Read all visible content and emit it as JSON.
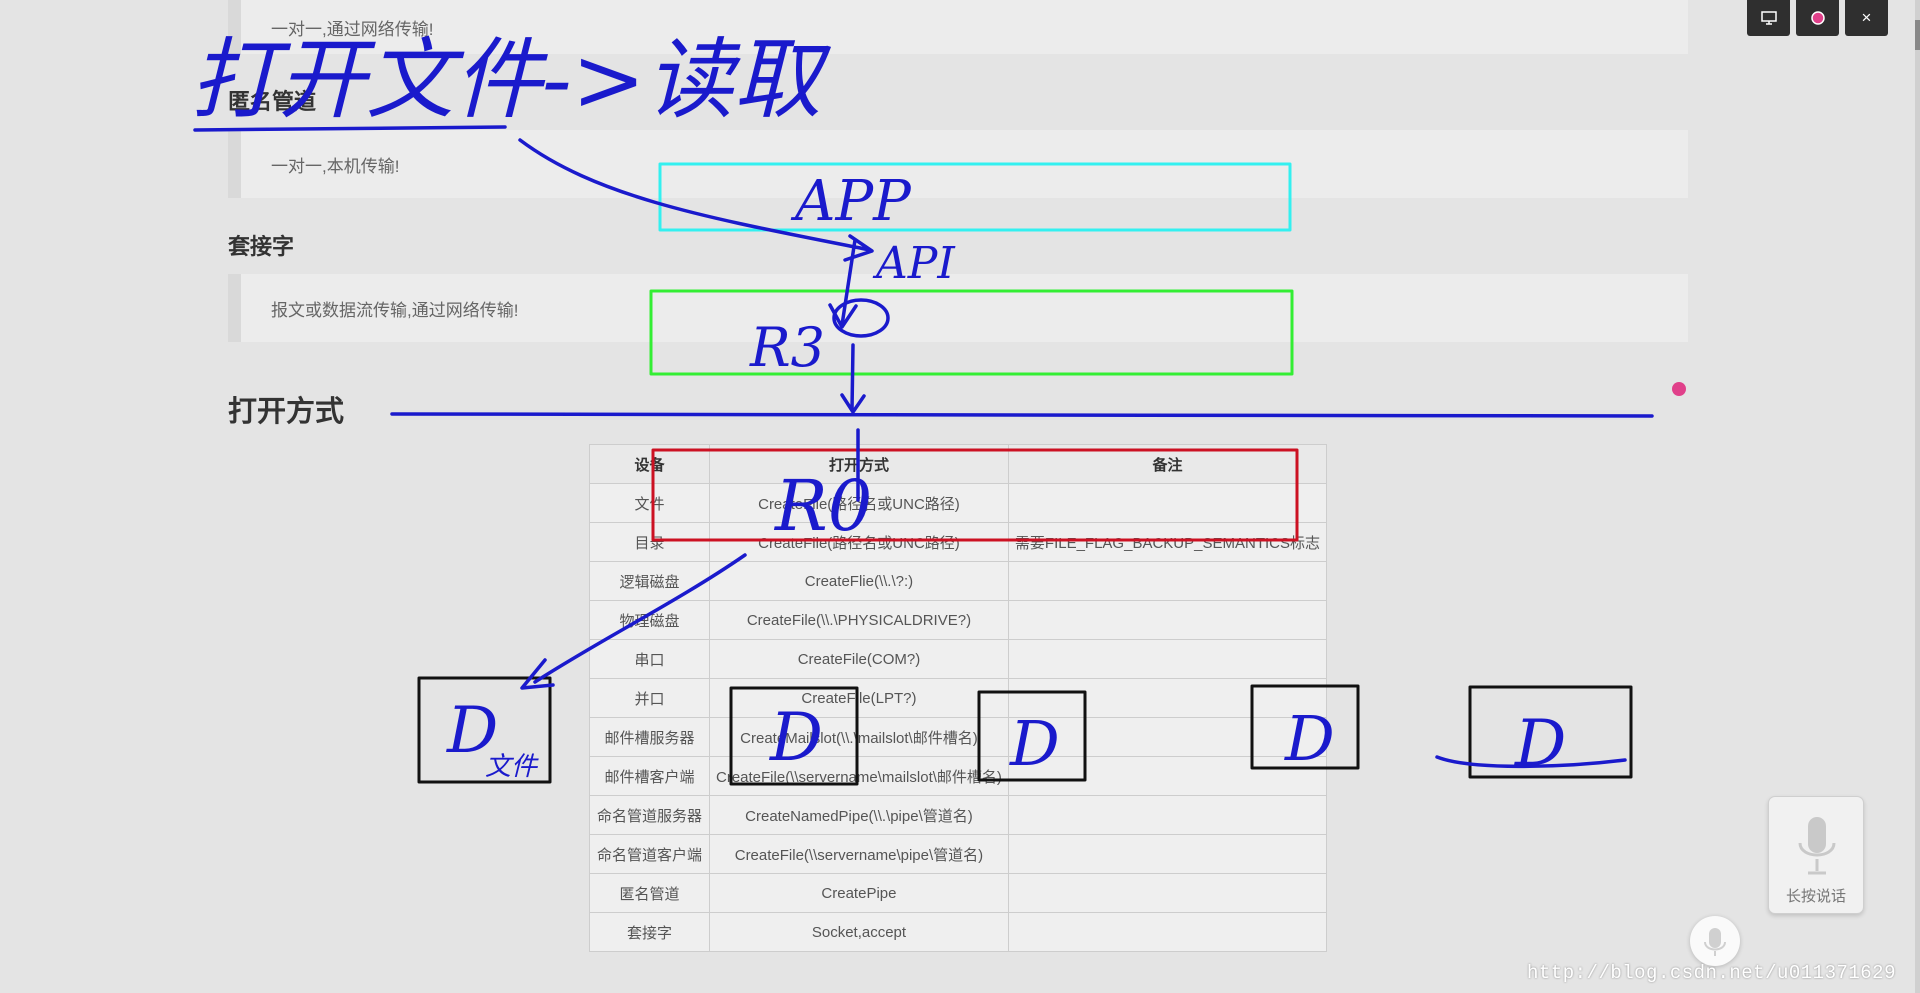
{
  "sections": {
    "top_note": "一对一,通过网络传输!",
    "anon_pipe_title": "匿名管道",
    "anon_pipe_note": "一对一,本机传输!",
    "socket_title": "套接字",
    "socket_note": "报文或数据流传输,通过网络传输!",
    "open_method_title": "打开方式"
  },
  "table": {
    "headers": [
      "设备",
      "打开方式",
      "备注"
    ],
    "rows": [
      [
        "文件",
        "CreateFile(路径名或UNC路径)",
        ""
      ],
      [
        "目录",
        "CreateFile(路径名或UNC路径)",
        "需要FILE_FLAG_BACKUP_SEMANTICS标志"
      ],
      [
        "逻辑磁盘",
        "CreateFlie(\\\\.\\?:)",
        ""
      ],
      [
        "物理磁盘",
        "CreateFile(\\\\.\\PHYSICALDRIVE?)",
        ""
      ],
      [
        "串口",
        "CreateFile(COM?)",
        ""
      ],
      [
        "并口",
        "CreateFile(LPT?)",
        ""
      ],
      [
        "邮件槽服务器",
        "CreateMailslot(\\\\.\\mailslot\\邮件槽名)",
        ""
      ],
      [
        "邮件槽客户端",
        "CreateFile(\\\\servername\\mailslot\\邮件槽名)",
        ""
      ],
      [
        "命名管道服务器",
        "CreateNamedPipe(\\\\.\\pipe\\管道名)",
        ""
      ],
      [
        "命名管道客户端",
        "CreateFile(\\\\servername\\pipe\\管道名)",
        ""
      ],
      [
        "匿名管道",
        "CreatePipe",
        ""
      ],
      [
        "套接字",
        "Socket,accept",
        ""
      ]
    ]
  },
  "toolbar": {
    "screen_icon": "monitor-icon",
    "record_icon": "record-icon",
    "close_label": "×"
  },
  "voice": {
    "label": "长按说话",
    "icon": "microphone-icon"
  },
  "annotations": {
    "title": "打开文件->读取",
    "app": "APP",
    "api": "API",
    "r3": "R3",
    "r0": "R0",
    "driver_main": "D",
    "driver_sub": "文件",
    "driver_b": "D",
    "driver_c": "D",
    "driver_d": "D",
    "driver_e": "D"
  },
  "watermark": "http://blog.csdn.net/u011371629",
  "colors": {
    "ink_blue": "#1a1acc",
    "app_box": "#33f0f0",
    "r3_box": "#33ee33",
    "r0_box": "#cc1122",
    "record_dot": "#e0408a"
  }
}
